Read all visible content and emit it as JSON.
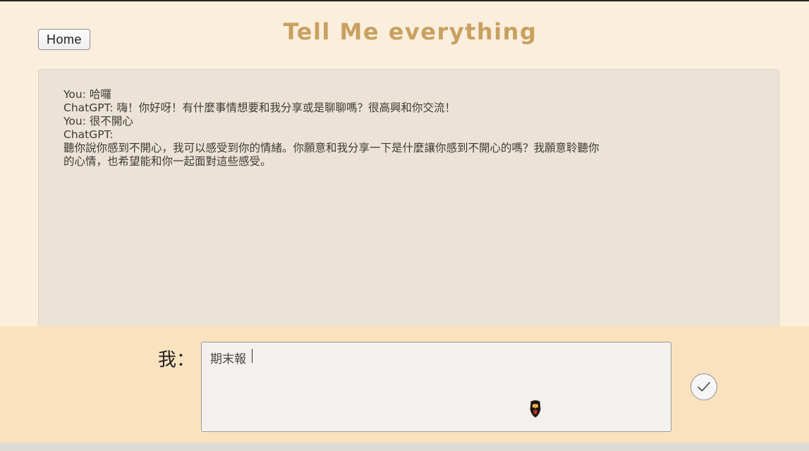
{
  "header": {
    "home_label": "Home",
    "title": "Tell Me everything"
  },
  "chat": {
    "lines": [
      "You: 哈囉",
      "ChatGPT: 嗨！你好呀！有什麼事情想要和我分享或是聊聊嗎？很高興和你交流！",
      "You: 很不開心",
      "ChatGPT:",
      "聽你說你感到不開心，我可以感受到你的情緒。你願意和我分享一下是什麼讓你感到不開心的嗎？我願意聆聽你",
      "的心情，也希望能和你一起面對這些感受。"
    ]
  },
  "composer": {
    "me_label": "我：",
    "input_value": "期末報"
  },
  "icons": {
    "send": "check-icon",
    "cursor": "mouse-cursor-icon"
  },
  "colors": {
    "title": "#c9a060",
    "background": "#faeedd",
    "input_bar": "#fbe2bf",
    "chat_panel": "#ece3d7"
  }
}
